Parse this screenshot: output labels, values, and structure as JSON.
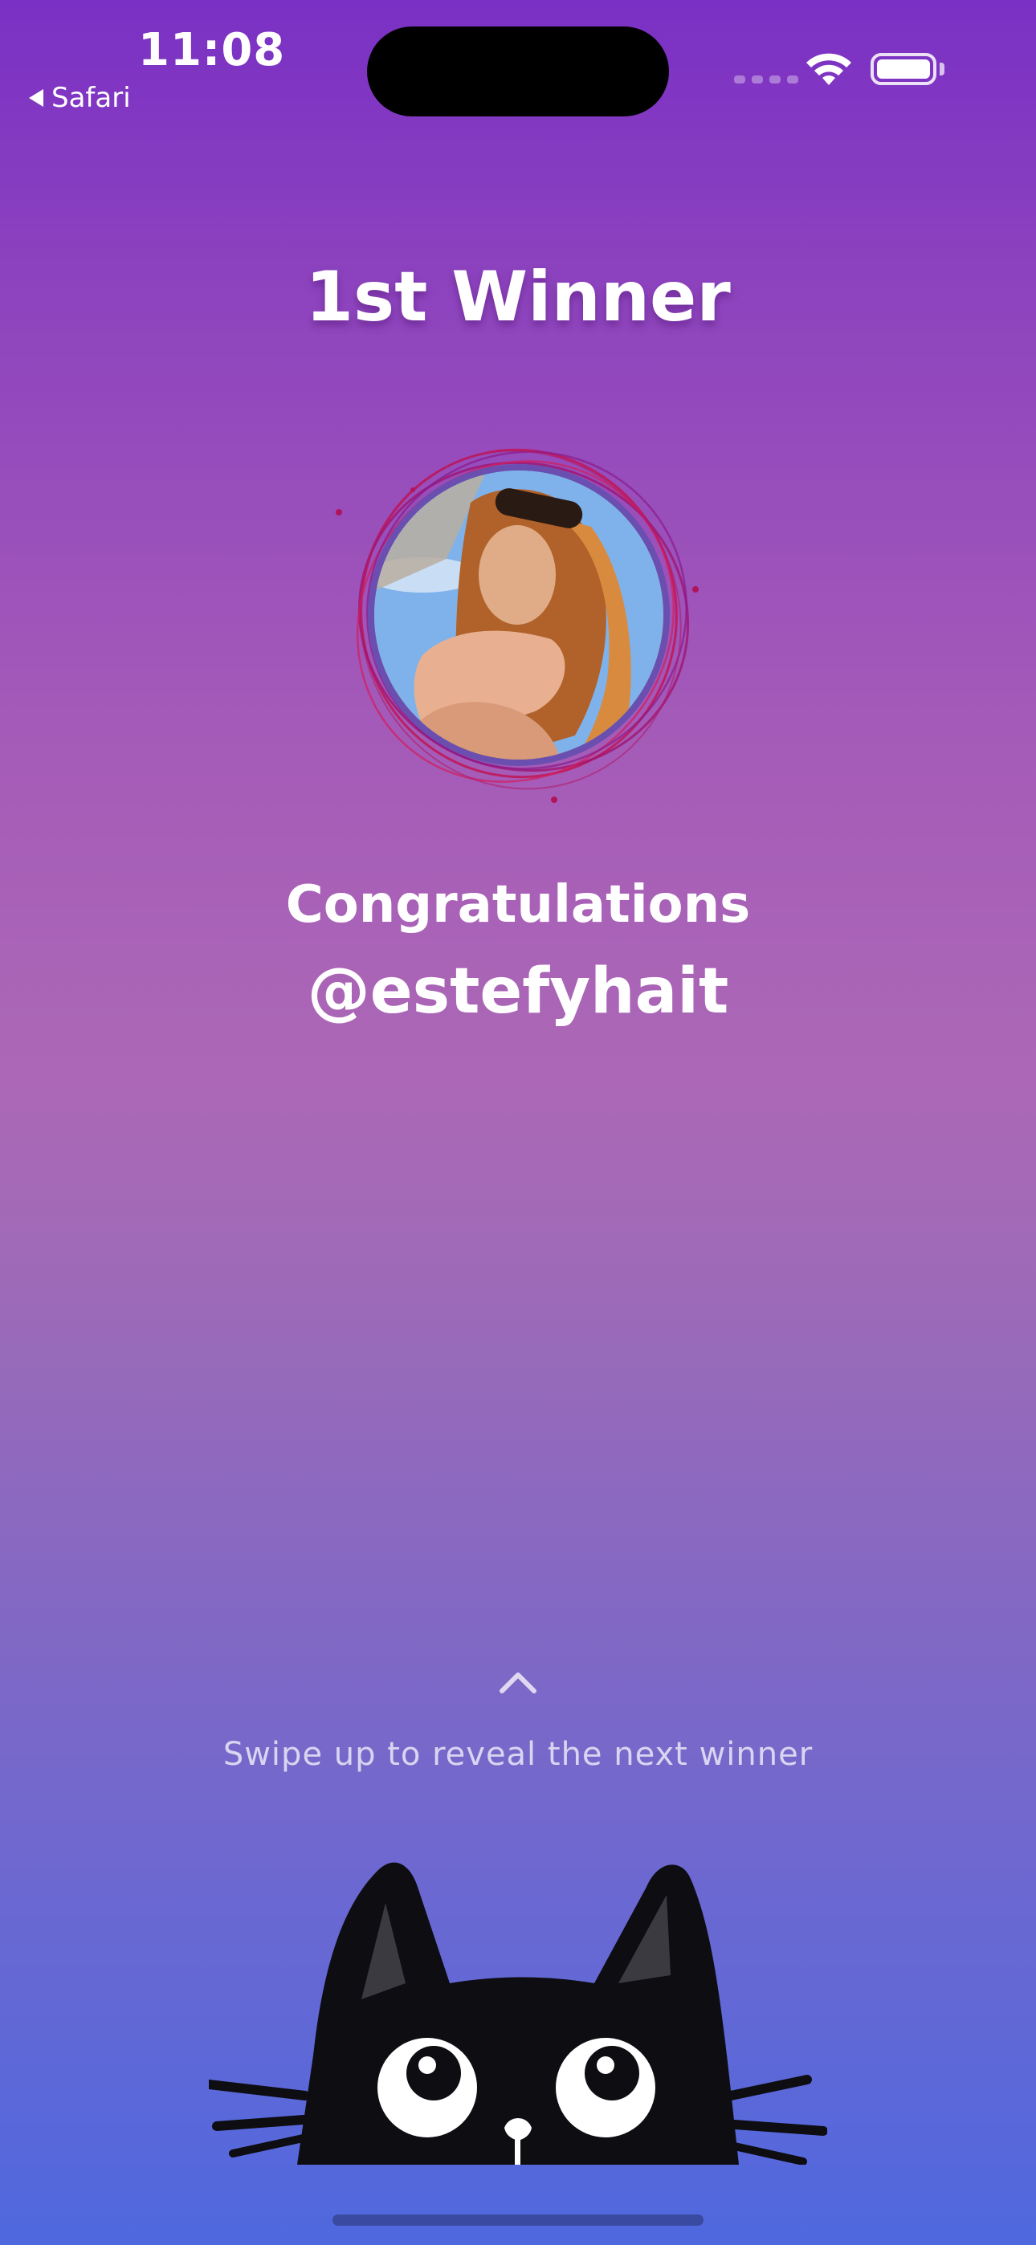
{
  "status_bar": {
    "time": "11:08",
    "back_label": "Safari",
    "back_icon": "back-triangle-icon",
    "wifi_icon": "wifi-icon",
    "battery_icon": "battery-icon"
  },
  "winner": {
    "title": "1st Winner",
    "congrats": "Congratulations",
    "handle": "@estefyhait"
  },
  "hint": {
    "icon": "chevron-up-icon",
    "text": "Swipe up to reveal the next winner"
  },
  "colors": {
    "gradient_top": "#7a30c4",
    "gradient_middle": "#ac68b6",
    "gradient_bottom": "#4f68de",
    "ring_accent": "#c0185a"
  }
}
